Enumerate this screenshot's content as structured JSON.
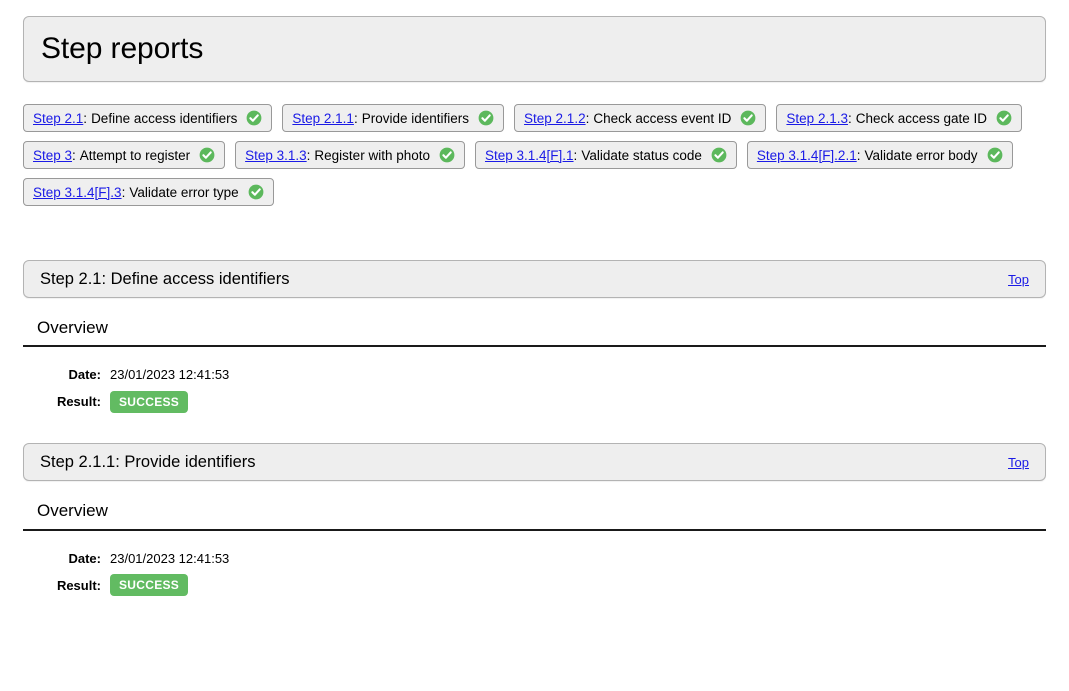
{
  "page": {
    "title": "Step reports"
  },
  "chips": [
    {
      "link": "Step 2.1",
      "separator": ":",
      "text": "Define access identifiers",
      "status": "success",
      "status_icon": "check-circle-icon"
    },
    {
      "link": "Step 2.1.1",
      "separator": ":",
      "text": "Provide identifiers",
      "status": "success",
      "status_icon": "check-circle-icon"
    },
    {
      "link": "Step 2.1.2",
      "separator": ":",
      "text": "Check access event ID",
      "status": "success",
      "status_icon": "check-circle-icon"
    },
    {
      "link": "Step 2.1.3",
      "separator": ":",
      "text": "Check access gate ID",
      "status": "success",
      "status_icon": "check-circle-icon"
    },
    {
      "link": "Step 3",
      "separator": ":",
      "text": "Attempt to register",
      "status": "success",
      "status_icon": "check-circle-icon"
    },
    {
      "link": "Step 3.1.3",
      "separator": ":",
      "text": "Register with photo",
      "status": "success",
      "status_icon": "check-circle-icon"
    },
    {
      "link": "Step 3.1.4[F].1",
      "separator": ":",
      "text": "Validate status code",
      "status": "success",
      "status_icon": "check-circle-icon"
    },
    {
      "link": "Step 3.1.4[F].2.1",
      "separator": ":",
      "text": "Validate error body",
      "status": "success",
      "status_icon": "check-circle-icon"
    },
    {
      "link": "Step 3.1.4[F].3",
      "separator": ":",
      "text": "Validate error type",
      "status": "success",
      "status_icon": "check-circle-icon"
    }
  ],
  "sections": [
    {
      "title": "Step 2.1: Define access identifiers",
      "top_link": "Top",
      "overview_heading": "Overview",
      "date_label": "Date:",
      "date_value": "23/01/2023 12:41:53",
      "result_label": "Result:",
      "result_value": "SUCCESS"
    },
    {
      "title": "Step 2.1.1: Provide identifiers",
      "top_link": "Top",
      "overview_heading": "Overview",
      "date_label": "Date:",
      "date_value": "23/01/2023 12:41:53",
      "result_label": "Result:",
      "result_value": "SUCCESS"
    }
  ],
  "colors": {
    "panel_bg": "#eeeeee",
    "panel_border": "#b3b3b3",
    "link": "#1a1ae6",
    "success_green": "#62bb62",
    "icon_green": "#5cb85c",
    "rule": "#1a1a1a"
  }
}
